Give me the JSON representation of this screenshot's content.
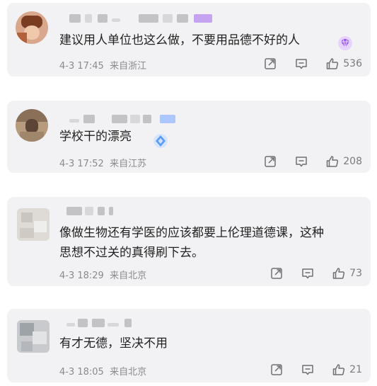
{
  "comments": [
    {
      "text": "建议用人单位也这么做，不要用品德不好的人",
      "time": "4-3 17:45",
      "location": "来自浙江",
      "likes": "536",
      "badge": "purple-gem-badge"
    },
    {
      "text": "学校干的漂亮",
      "time": "4-3 17:52",
      "location": "来自江苏",
      "likes": "208",
      "badge": "blue-gem-badge"
    },
    {
      "text_line1": "像做生物还有学医的应该都要上伦理道德课，这种",
      "text_line2": "思想不过关的真得刷下去。",
      "time": "4-3 18:29",
      "location": "来自北京",
      "likes": "73"
    },
    {
      "text": "有才无德，坚决不用",
      "time": "4-3 18:05",
      "location": "来自北京",
      "likes": "21"
    }
  ],
  "colors": {
    "card_bg": "#f2f2f4",
    "text": "#222222",
    "meta": "#8a8a8e",
    "icon": "#6f6f73"
  }
}
